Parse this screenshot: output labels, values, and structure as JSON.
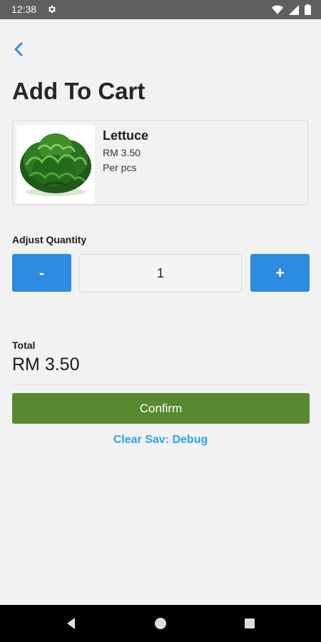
{
  "status_bar": {
    "time": "12:38",
    "icons": [
      "gear-icon",
      "wifi-icon",
      "signal-icon",
      "battery-icon"
    ]
  },
  "header": {
    "back_icon": "chevron-left-icon",
    "title": "Add To Cart"
  },
  "product": {
    "name": "Lettuce",
    "price": "RM 3.50",
    "unit": "Per pcs",
    "image": "lettuce-image"
  },
  "quantity": {
    "label": "Adjust Quantity",
    "minus_label": "-",
    "value": "1",
    "plus_label": "+"
  },
  "total": {
    "label": "Total",
    "value": "RM 3.50"
  },
  "actions": {
    "confirm_label": "Confirm",
    "clear_label": "Clear Sav: Debug"
  },
  "nav_bar": {
    "icons": [
      "back-triangle-icon",
      "home-circle-icon",
      "recents-square-icon"
    ]
  },
  "colors": {
    "accent_blue": "#2c8ce0",
    "confirm_green": "#578a30",
    "link_blue": "#2ca3e8",
    "status_bar": "#5f5f5f"
  }
}
